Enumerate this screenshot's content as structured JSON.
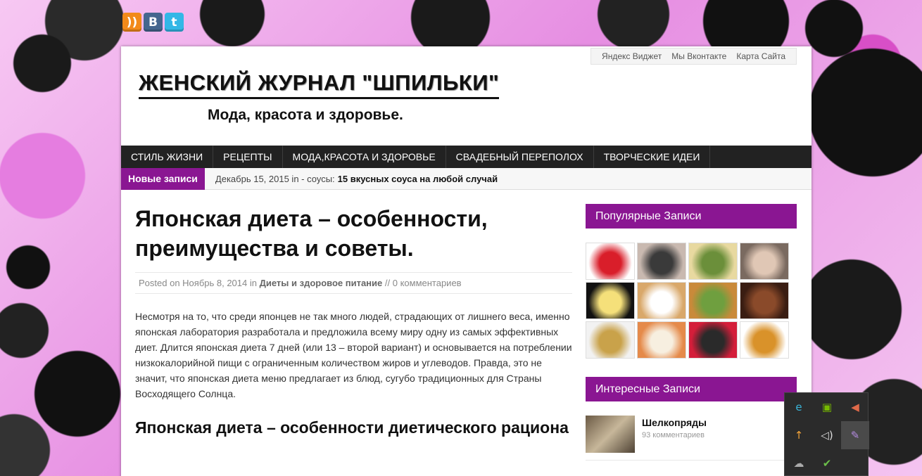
{
  "social": [
    {
      "name": "rss",
      "glyph": "))"
    },
    {
      "name": "vk",
      "glyph": "B"
    },
    {
      "name": "twitter",
      "glyph": "t"
    }
  ],
  "toplinks": [
    "Яндекс Виджет",
    "Мы Вконтакте",
    "Карта Сайта"
  ],
  "site": {
    "title": "ЖЕНСКИЙ ЖУРНАЛ \"ШПИЛЬКИ\"",
    "subtitle": "Мода, красота и здоровье."
  },
  "nav": [
    "СТИЛЬ ЖИЗНИ",
    "РЕЦЕПТЫ",
    "МОДА,КРАСОТА И ЗДОРОВЬЕ",
    "СВАДЕБНЫЙ ПЕРЕПОЛОХ",
    "ТВОРЧЕСКИЕ ИДЕИ"
  ],
  "ticker": {
    "label": "Новые записи",
    "date": "Декабрь 15, 2015 in - соусы:",
    "title": "15 вкусных соуса на любой случай"
  },
  "post": {
    "title": "Японская диета – особенности, преимущества и советы.",
    "meta_prefix": "Posted on Ноябрь 8, 2014 in",
    "meta_category": "Диеты и здоровое питание",
    "meta_comments": "// 0 комментариев",
    "body": "Несмотря на то, что среди японцев не так много людей, страдающих от лишнего веса, именно японская лаборатория разработала и предложила всему миру одну из самых эффективных диет. Длится японская диета 7 дней (или 13 – второй вариант) и основывается на потреблении низкокалорийной пищи с ограниченным количеством жиров и углеводов. Правда, это не значит, что японская диета меню предлагает из блюд, сугубо традиционных для Страны Восходящего Солнца.",
    "h2": "Японская диета – особенности диетического рациона"
  },
  "sidebar": {
    "popular_title": "Популярные Записи",
    "popular_thumbs": [
      {
        "colors": [
          "#ffffff",
          "#d91e2a"
        ]
      },
      {
        "colors": [
          "#c9b9b0",
          "#3a3a3a"
        ]
      },
      {
        "colors": [
          "#e8d9a0",
          "#6b8f3a"
        ]
      },
      {
        "colors": [
          "#7a6a60",
          "#e0c7b5"
        ]
      },
      {
        "colors": [
          "#111111",
          "#f5e07a"
        ]
      },
      {
        "colors": [
          "#d9a86a",
          "#ffffff"
        ]
      },
      {
        "colors": [
          "#c98a3a",
          "#6f9f3f"
        ]
      },
      {
        "colors": [
          "#3a1d12",
          "#8a4a2a"
        ]
      },
      {
        "colors": [
          "#f2f2f2",
          "#c9a24a"
        ]
      },
      {
        "colors": [
          "#e58a4a",
          "#f7efe0"
        ]
      },
      {
        "colors": [
          "#d41e3a",
          "#2a2a2a"
        ]
      },
      {
        "colors": [
          "#ffffff",
          "#d9922a"
        ]
      }
    ],
    "interesting_title": "Интересные Записи",
    "interesting": [
      {
        "name": "Шелкопряды",
        "count": "93 комментариев"
      }
    ]
  },
  "tray": [
    {
      "icon": "ie-icon",
      "glyph": "e",
      "color": "#39b5d9"
    },
    {
      "icon": "nvidia-icon",
      "glyph": "▣",
      "color": "#76b900"
    },
    {
      "icon": "speaker-muted-icon",
      "glyph": "◀",
      "color": "#e06a4a"
    },
    {
      "icon": "update-icon",
      "glyph": "↑",
      "color": "#f2a33a"
    },
    {
      "icon": "volume-icon",
      "glyph": "◁)",
      "color": "#dddddd"
    },
    {
      "icon": "feather-icon",
      "glyph": "✎",
      "color": "#b48be0"
    },
    {
      "icon": "cloud-icon",
      "glyph": "☁",
      "color": "#aaaaaa"
    },
    {
      "icon": "chat-icon",
      "glyph": "✔",
      "color": "#6cc04a"
    }
  ]
}
